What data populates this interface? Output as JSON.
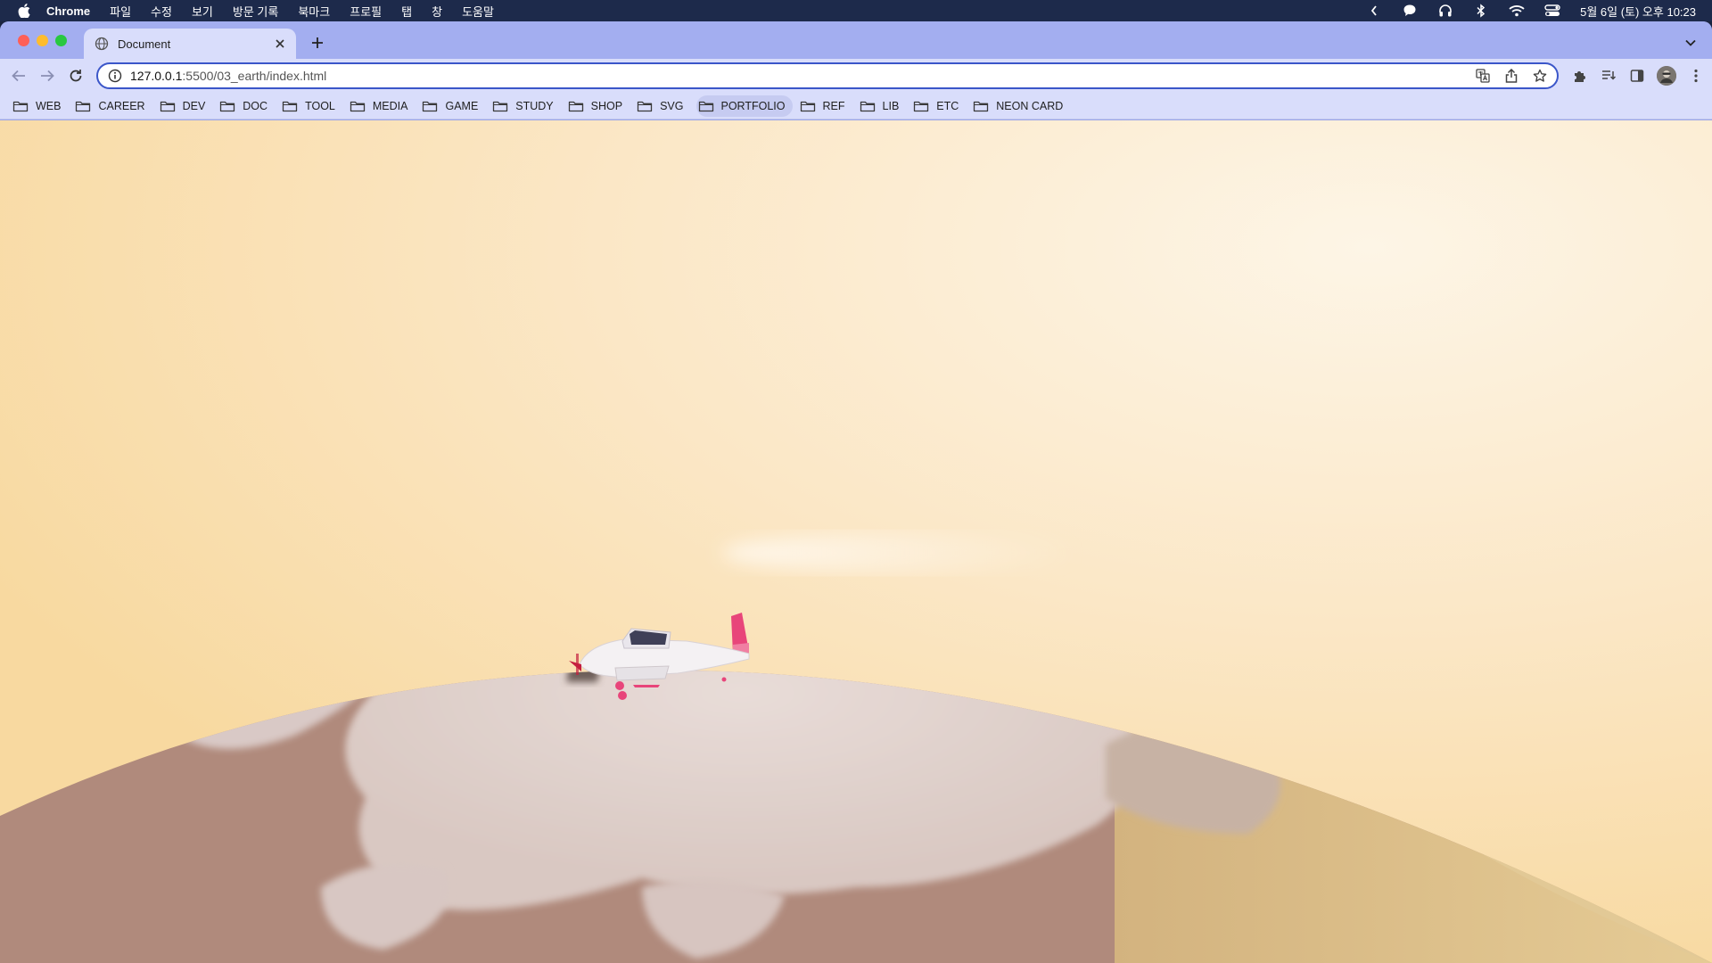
{
  "menubar": {
    "app_name": "Chrome",
    "items": [
      "파일",
      "수정",
      "보기",
      "방문 기록",
      "북마크",
      "프로필",
      "탭",
      "창",
      "도움말"
    ],
    "clock": "5월 6일 (토) 오후 10:23"
  },
  "tab": {
    "title": "Document"
  },
  "address": {
    "host": "127.0.0.1",
    "path": ":5500/03_earth/index.html"
  },
  "bookmarks": [
    "WEB",
    "CAREER",
    "DEV",
    "DOC",
    "TOOL",
    "MEDIA",
    "GAME",
    "STUDY",
    "SHOP",
    "SVG",
    "PORTFOLIO",
    "REF",
    "LIB",
    "ETC",
    "NEON CARD"
  ],
  "active_bookmark": "PORTFOLIO",
  "colors": {
    "menubar": "#1d2a4b",
    "tabstrip": "#a3aef0",
    "toolbar": "#d9ddfb",
    "sky": "#fbe6c2",
    "planet_snow": "#e4d7d3",
    "planet_rock": "#a67d72",
    "plane_accent": "#e8457a"
  }
}
